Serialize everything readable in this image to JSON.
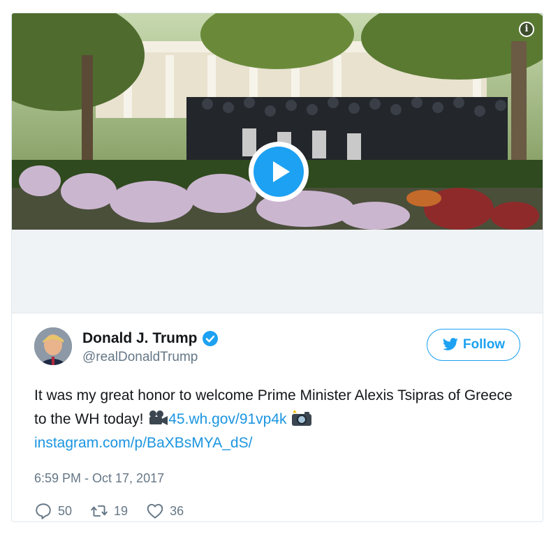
{
  "media": {
    "info_icon": "info-icon",
    "play_icon": "play-icon"
  },
  "tweet": {
    "display_name": "Donald J. Trump",
    "verified_icon": "verified-badge-icon",
    "handle": "@realDonaldTrump",
    "follow_label": "Follow",
    "follow_icon": "twitter-bird-icon",
    "text_part1": "It was my great honor to welcome Prime Minister Alexis Tsipras of Greece to the WH today! ",
    "emoji_camera": "movie-camera-icon",
    "link1": "45.wh.gov/91vp4k",
    "emoji_photo": "camera-flash-icon",
    "link2": "instagram.com/p/BaXBsMYA_dS/",
    "timestamp": "6:59 PM - Oct 17, 2017",
    "replies": "50",
    "retweets": "19",
    "likes": "36"
  },
  "colors": {
    "accent": "#1da1f2",
    "link": "#1b95e0",
    "muted": "#657786",
    "text": "#14171a"
  }
}
